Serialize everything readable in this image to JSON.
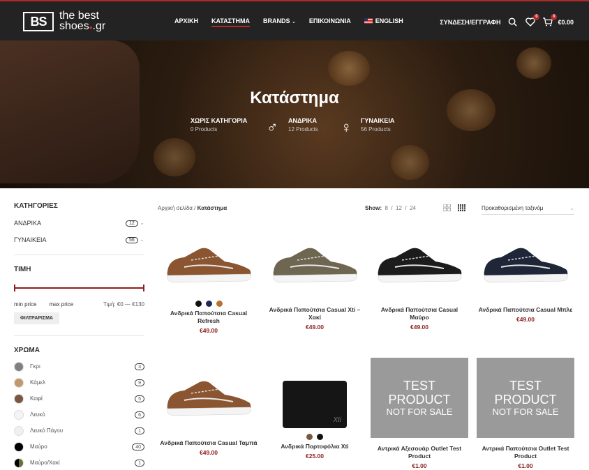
{
  "header": {
    "logo_mark": "BS",
    "logo_line1": "the best",
    "logo_line2": "shoes",
    "logo_suffix": ".gr",
    "nav": [
      "ΑΡΧΙΚΗ",
      "ΚΑΤΑΣΤΗΜΑ",
      "BRANDS",
      "ΕΠΙΚΟΙΝΩΝΙΑ",
      "ENGLISH"
    ],
    "login": "ΣΥΝΔΕΣΗ/ΕΓΓΡΑΦΗ",
    "wishlist_count": "0",
    "cart_count": "0",
    "cart_total": "€0.00"
  },
  "hero": {
    "title": "Κατάστημα",
    "categories": [
      {
        "name": "ΧΩΡΙΣ ΚΑΤΗΓΟΡΙΑ",
        "count": "0 Products"
      },
      {
        "name": "ΑΝΔΡΙΚΑ",
        "count": "12 Products"
      },
      {
        "name": "ΓΥΝΑΙΚΕΙΑ",
        "count": "56 Products"
      }
    ]
  },
  "sidebar": {
    "cat_title": "ΚΑΤΗΓΟΡΙΕΣ",
    "cats": [
      {
        "label": "ΑΝΔΡΙΚΑ",
        "count": "12"
      },
      {
        "label": "ΓΥΝΑΙΚΕΙΑ",
        "count": "56"
      }
    ],
    "price_title": "ΤΙΜΗ",
    "min_price": "min price",
    "max_price": "max price",
    "price_range": "Τιμή: €0 — €130",
    "filter_btn": "ΦΙΛΤΡΑΡΙΣΜΑ",
    "color_title": "ΧΡΩΜΑ",
    "colors": [
      {
        "label": "Γκρι",
        "count": "3",
        "hex": "#808080"
      },
      {
        "label": "Κάμελ",
        "count": "9",
        "hex": "#c19a6b"
      },
      {
        "label": "Καφέ",
        "count": "5",
        "hex": "#7b5640"
      },
      {
        "label": "Λευκό",
        "count": "6",
        "hex": "#f4f4f4"
      },
      {
        "label": "Λευκό Πάγου",
        "count": "1",
        "hex": "#eef2ef"
      },
      {
        "label": "Μαύρο",
        "count": "40",
        "hex": "#000000"
      },
      {
        "label": "Μαύρο/Χακί",
        "count": "1",
        "hex": "#6b6b3a"
      }
    ]
  },
  "toolbar": {
    "bc_home": "Αρχική σελίδα",
    "bc_sep": "/",
    "bc_current": "Κατάστημα",
    "show_label": "Show",
    "show_opts": [
      "8",
      "12",
      "24"
    ],
    "sort": "Προκαθορισμένη ταξινόμ"
  },
  "products": [
    {
      "name": "Ανδρικά Παπούτσια Casual Refresh",
      "price": "€49.00",
      "dots": [
        "#111",
        "#1a2a5a",
        "#b5722e"
      ],
      "color": "#8a5530"
    },
    {
      "name": "Ανδρικά Παπούτσια Casual Xti – Χακί",
      "price": "€49.00",
      "color": "#6e6650"
    },
    {
      "name": "Ανδρικά Παπούτσια Casual Μαύρο",
      "price": "€49.00",
      "color": "#1c1c1c"
    },
    {
      "name": "Ανδρικά Παπούτσια Casual Μπλε",
      "price": "€49.00",
      "color": "#1e2638"
    },
    {
      "name": "Ανδρικά Παπούτσια Casual Ταμπά",
      "price": "€49.00",
      "color": "#8a5530"
    },
    {
      "name": "Ανδρικά Πορτοφόλια Xti",
      "price": "€25.00",
      "dots": [
        "#7b5640",
        "#111"
      ],
      "wallet_brand": "Xti"
    },
    {
      "name": "Αντρικά Αξεσουάρ Outlet Test Product",
      "price": "€1.00",
      "test": [
        "TEST",
        "PRODUCT",
        "NOT FOR SALE"
      ]
    },
    {
      "name": "Αντρικά Παπούτσια Outlet Test Product",
      "price": "€1.00",
      "test": [
        "TEST",
        "PRODUCT",
        "NOT FOR SALE"
      ]
    }
  ]
}
